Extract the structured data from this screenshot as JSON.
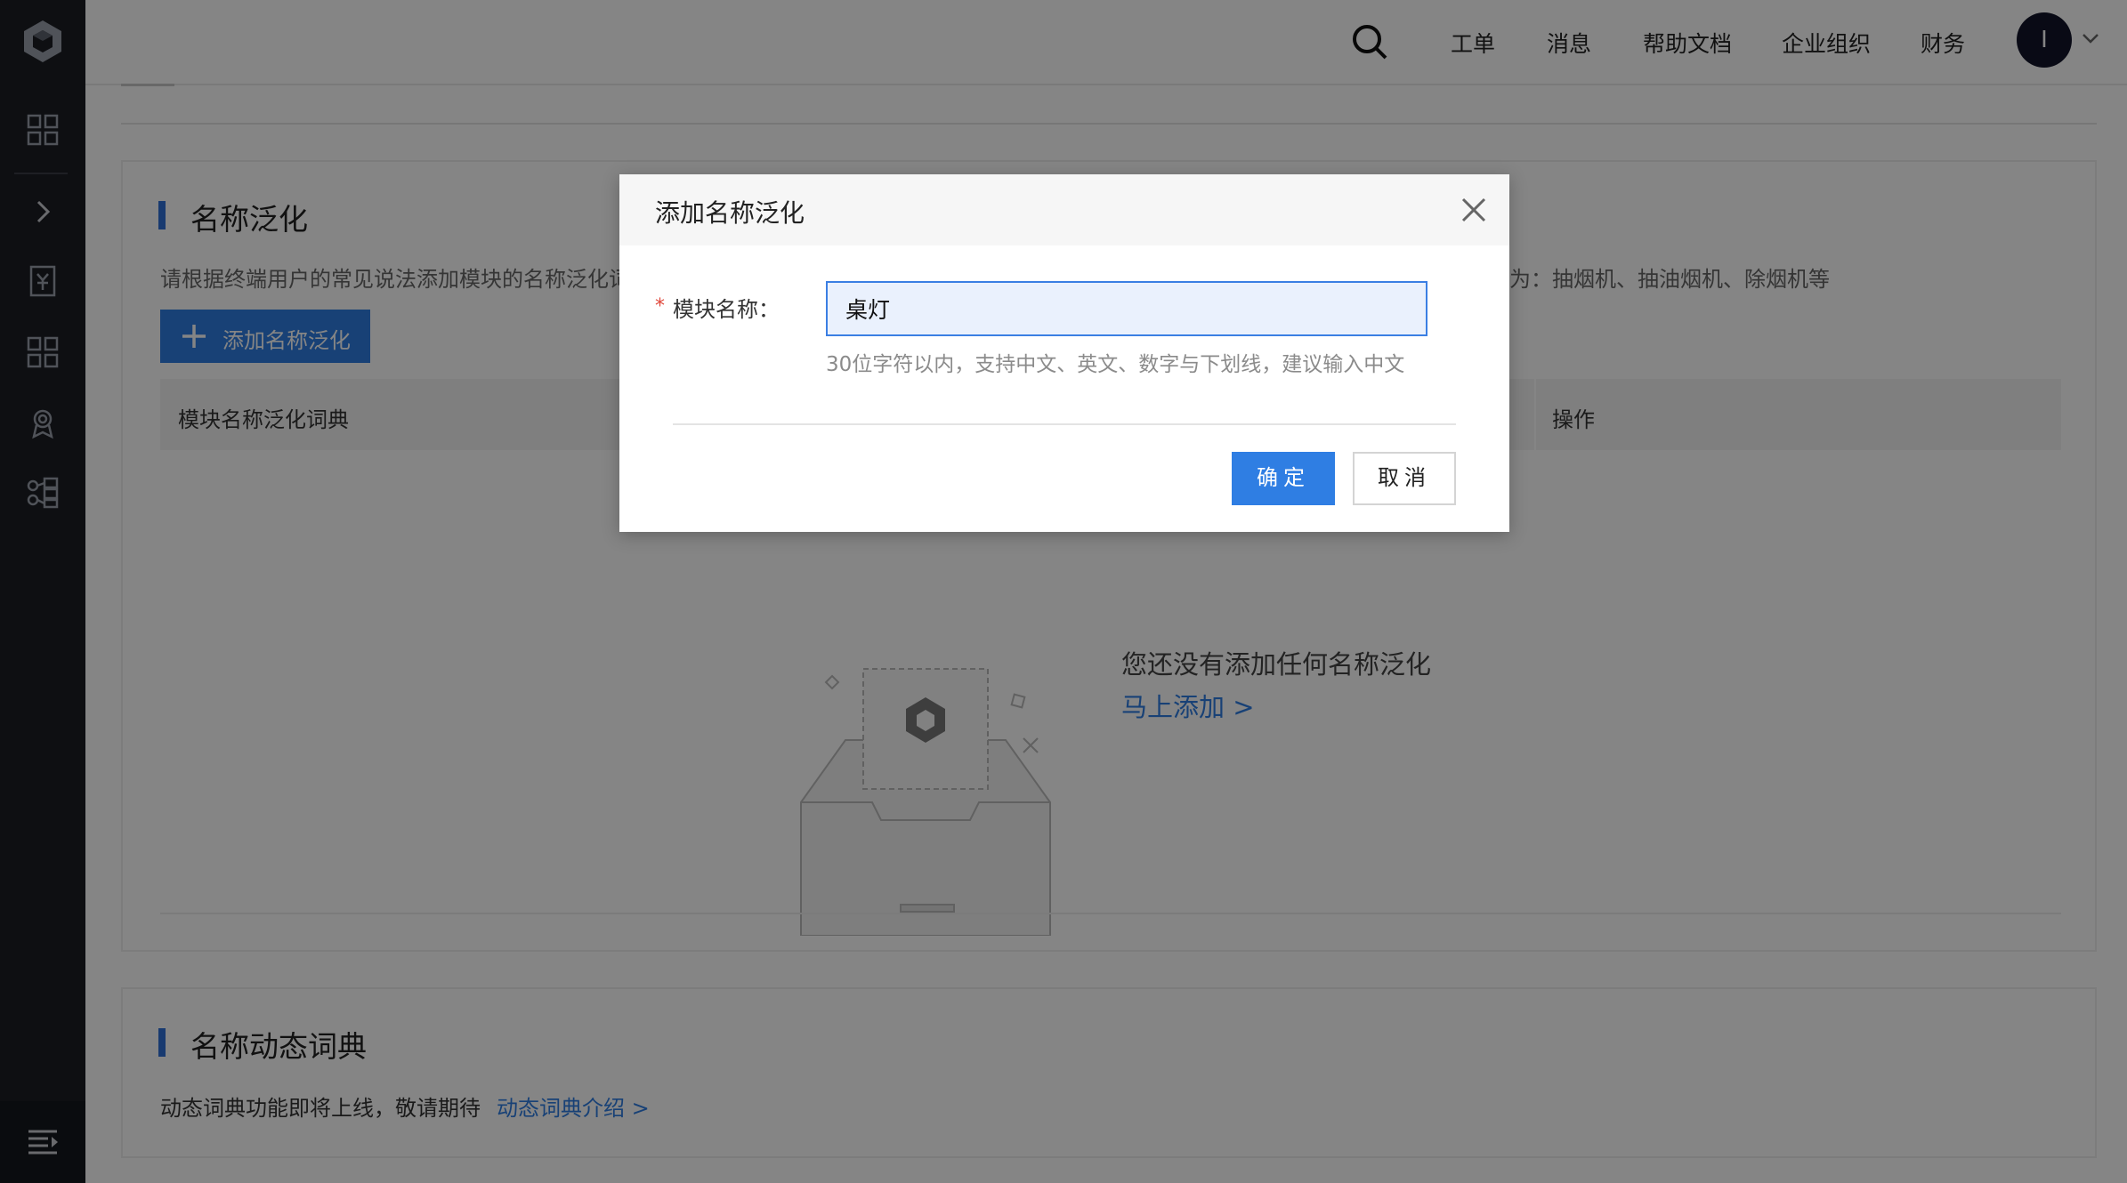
{
  "header": {
    "links": [
      "工单",
      "消息",
      "帮助文档",
      "企业组织",
      "财务"
    ],
    "avatar_initial": "I"
  },
  "section_generalization": {
    "title": "名称泛化",
    "description_left": "请根据终端用户的常见说法添加模块的名称泛化词",
    "description_right": "为：抽烟机、抽油烟机、除烟机等",
    "add_button_label": "添加名称泛化",
    "table_headers": [
      "模块名称泛化词典",
      "操作"
    ],
    "empty_text": "您还没有添加任何名称泛化",
    "empty_link": "马上添加 >"
  },
  "section_dynamic": {
    "title": "名称动态词典",
    "description": "动态词典功能即将上线，敬请期待",
    "link": "动态词典介绍 >"
  },
  "modal": {
    "title": "添加名称泛化",
    "required_mark": "*",
    "field_label": "模块名称：",
    "field_value": "桌灯",
    "field_hint": "30位字符以内，支持中文、英文、数字与下划线，建议输入中文",
    "ok_label": "确定",
    "cancel_label": "取消"
  },
  "colors": {
    "sidebar_bg": "#1b1d24",
    "accent_blue": "#2f7ee3",
    "required_red": "#e0483c"
  },
  "icons": {
    "sidebar": [
      "logo-icon",
      "dashboard-grid-icon",
      "expand-chevron-icon",
      "billing-icon",
      "apps-grid-icon",
      "certificate-icon",
      "module-tree-icon",
      "collapse-menu-icon"
    ],
    "header": [
      "search-icon",
      "chevron-down-icon"
    ],
    "modal": [
      "close-icon"
    ]
  }
}
